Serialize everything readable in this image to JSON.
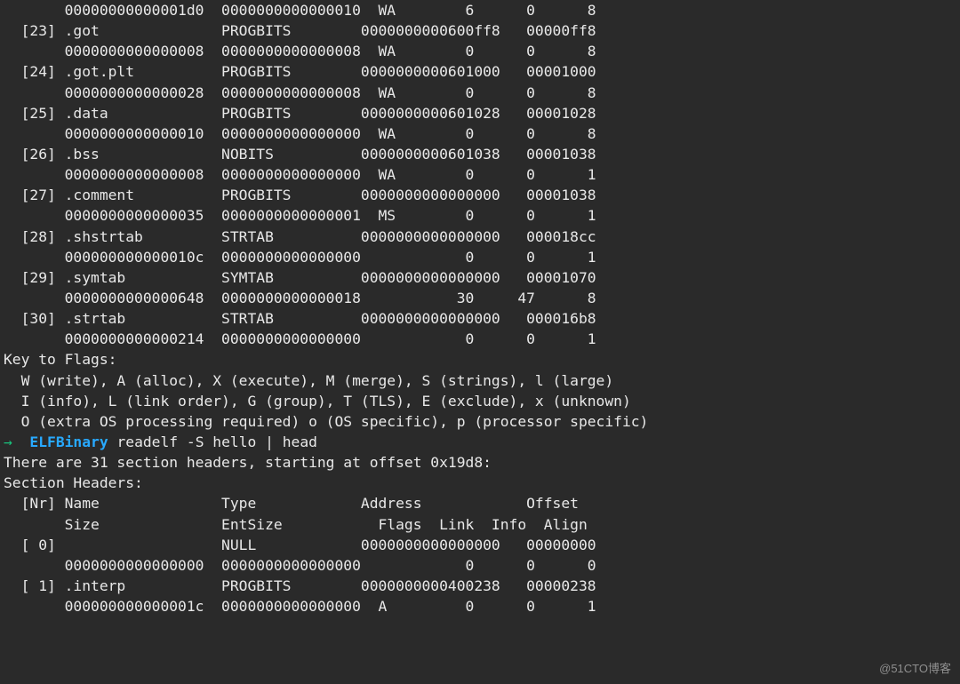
{
  "top_partial_row": {
    "size": "00000000000001d0",
    "entsize": "0000000000000010",
    "flags": "WA",
    "link": "6",
    "info": "0",
    "align": "8"
  },
  "sections": [
    {
      "nr": "[23]",
      "name": ".got",
      "type": "PROGBITS",
      "addr": "0000000000600ff8",
      "off": "00000ff8",
      "size": "0000000000000008",
      "entsize": "0000000000000008",
      "flags": "WA",
      "link": "0",
      "info": "0",
      "align": "8"
    },
    {
      "nr": "[24]",
      "name": ".got.plt",
      "type": "PROGBITS",
      "addr": "0000000000601000",
      "off": "00001000",
      "size": "0000000000000028",
      "entsize": "0000000000000008",
      "flags": "WA",
      "link": "0",
      "info": "0",
      "align": "8"
    },
    {
      "nr": "[25]",
      "name": ".data",
      "type": "PROGBITS",
      "addr": "0000000000601028",
      "off": "00001028",
      "size": "0000000000000010",
      "entsize": "0000000000000000",
      "flags": "WA",
      "link": "0",
      "info": "0",
      "align": "8"
    },
    {
      "nr": "[26]",
      "name": ".bss",
      "type": "NOBITS",
      "addr": "0000000000601038",
      "off": "00001038",
      "size": "0000000000000008",
      "entsize": "0000000000000000",
      "flags": "WA",
      "link": "0",
      "info": "0",
      "align": "1"
    },
    {
      "nr": "[27]",
      "name": ".comment",
      "type": "PROGBITS",
      "addr": "0000000000000000",
      "off": "00001038",
      "size": "0000000000000035",
      "entsize": "0000000000000001",
      "flags": "MS",
      "link": "0",
      "info": "0",
      "align": "1"
    },
    {
      "nr": "[28]",
      "name": ".shstrtab",
      "type": "STRTAB",
      "addr": "0000000000000000",
      "off": "000018cc",
      "size": "000000000000010c",
      "entsize": "0000000000000000",
      "flags": "",
      "link": "0",
      "info": "0",
      "align": "1"
    },
    {
      "nr": "[29]",
      "name": ".symtab",
      "type": "SYMTAB",
      "addr": "0000000000000000",
      "off": "00001070",
      "size": "0000000000000648",
      "entsize": "0000000000000018",
      "flags": "",
      "link": "30",
      "info": "47",
      "align": "8"
    },
    {
      "nr": "[30]",
      "name": ".strtab",
      "type": "STRTAB",
      "addr": "0000000000000000",
      "off": "000016b8",
      "size": "0000000000000214",
      "entsize": "0000000000000000",
      "flags": "",
      "link": "0",
      "info": "0",
      "align": "1"
    }
  ],
  "key_header": "Key to Flags:",
  "key_lines": [
    "  W (write), A (alloc), X (execute), M (merge), S (strings), l (large)",
    "  I (info), L (link order), G (group), T (TLS), E (exclude), x (unknown)",
    "  O (extra OS processing required) o (OS specific), p (processor specific)"
  ],
  "prompt": {
    "arrow": "→",
    "dir": "ELFBinary",
    "command": "readelf -S hello | head"
  },
  "output_intro": "There are 31 section headers, starting at offset 0x19d8:",
  "blank": "",
  "section_headers_title": "Section Headers:",
  "columns": {
    "row1": {
      "nr": "[Nr]",
      "name": "Name",
      "type": "Type",
      "addr": "Address",
      "off": "Offset"
    },
    "row2": {
      "size": "Size",
      "entsize": "EntSize",
      "flags": "Flags",
      "link": "Link",
      "info": "Info",
      "align": "Align"
    }
  },
  "head_sections": [
    {
      "nr": "[ 0]",
      "name": "",
      "type": "NULL",
      "addr": "0000000000000000",
      "off": "00000000",
      "size": "0000000000000000",
      "entsize": "0000000000000000",
      "flags": "",
      "link": "0",
      "info": "0",
      "align": "0"
    },
    {
      "nr": "[ 1]",
      "name": ".interp",
      "type": "PROGBITS",
      "addr": "0000000000400238",
      "off": "00000238",
      "size": "000000000000001c",
      "entsize": "0000000000000000",
      "flags": "A",
      "link": "0",
      "info": "0",
      "align": "1"
    }
  ],
  "watermark": "@51CTO博客"
}
